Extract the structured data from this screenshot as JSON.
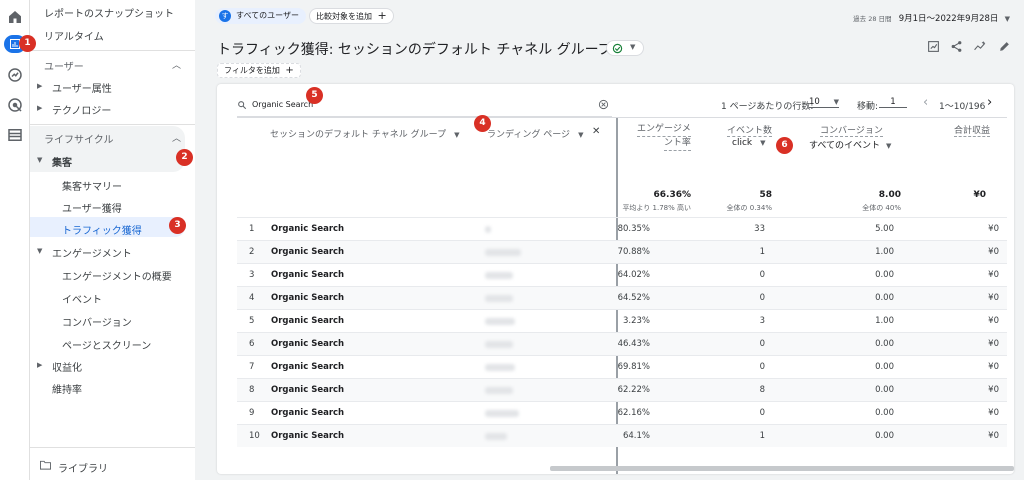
{
  "nav": {
    "snapshot": "レポートのスナップショット",
    "realtime": "リアルタイム",
    "user_section": "ユーザー",
    "user_attr": "ユーザー属性",
    "technology": "テクノロジー",
    "lifecycle": "ライフサイクル",
    "acquisition": "集客",
    "acq_overview": "集客サマリー",
    "user_acq": "ユーザー獲得",
    "traffic_acq": "トラフィック獲得",
    "engagement": "エンゲージメント",
    "eng_overview": "エンゲージメントの概要",
    "events": "イベント",
    "conversions": "コンバージョン",
    "pages": "ページとスクリーン",
    "monetization": "収益化",
    "retention": "維持率",
    "library": "ライブラリ"
  },
  "badges": [
    "1",
    "2",
    "3",
    "4",
    "5",
    "6"
  ],
  "top": {
    "all_users": "すべてのユーザー",
    "avatar": "す",
    "add_compare": "比較対象を追加",
    "date_prefix": "過去 28 日間",
    "date_range": "9月1日～2022年9月28日",
    "title": "トラフィック獲得: セッションのデフォルト チャネル グループ",
    "add_filter": "フィルタを追加"
  },
  "table": {
    "search": "Organic Search",
    "rows_label": "1 ページあたりの行数:",
    "rows_value": "10",
    "goto_label": "移動:",
    "goto_value": "1",
    "range": "1～10/196",
    "col_dim1": "セッションのデフォルト チャネル グループ",
    "col_dim2": "ランディング ページ",
    "col_eng1": "エンゲージメ",
    "col_eng2": "ント率",
    "col_events": "イベント数",
    "col_events_sel": "click",
    "col_conv": "コンバージョン",
    "col_conv_sel": "すべてのイベント",
    "col_rev": "合計収益",
    "tot_eng": "66.36%",
    "tot_eng_sub": "平均より 1.78% 高い",
    "tot_events": "58",
    "tot_events_sub": "全体の 0.34%",
    "tot_conv": "8.00",
    "tot_conv_sub": "全体の 40%",
    "tot_rev": "¥0",
    "rows": [
      {
        "n": "1",
        "ch": "Organic Search",
        "eng": "80.35%",
        "ev": "33",
        "cv": "5.00",
        "rev": "¥0"
      },
      {
        "n": "2",
        "ch": "Organic Search",
        "eng": "70.88%",
        "ev": "1",
        "cv": "1.00",
        "rev": "¥0"
      },
      {
        "n": "3",
        "ch": "Organic Search",
        "eng": "64.02%",
        "ev": "0",
        "cv": "0.00",
        "rev": "¥0"
      },
      {
        "n": "4",
        "ch": "Organic Search",
        "eng": "64.52%",
        "ev": "0",
        "cv": "0.00",
        "rev": "¥0"
      },
      {
        "n": "5",
        "ch": "Organic Search",
        "eng": "3.23%",
        "ev": "3",
        "cv": "1.00",
        "rev": "¥0"
      },
      {
        "n": "6",
        "ch": "Organic Search",
        "eng": "46.43%",
        "ev": "0",
        "cv": "0.00",
        "rev": "¥0"
      },
      {
        "n": "7",
        "ch": "Organic Search",
        "eng": "69.81%",
        "ev": "0",
        "cv": "0.00",
        "rev": "¥0"
      },
      {
        "n": "8",
        "ch": "Organic Search",
        "eng": "62.22%",
        "ev": "8",
        "cv": "0.00",
        "rev": "¥0"
      },
      {
        "n": "9",
        "ch": "Organic Search",
        "eng": "62.16%",
        "ev": "0",
        "cv": "0.00",
        "rev": "¥0"
      },
      {
        "n": "10",
        "ch": "Organic Search",
        "eng": "64.1%",
        "ev": "1",
        "cv": "0.00",
        "rev": "¥0"
      }
    ]
  }
}
